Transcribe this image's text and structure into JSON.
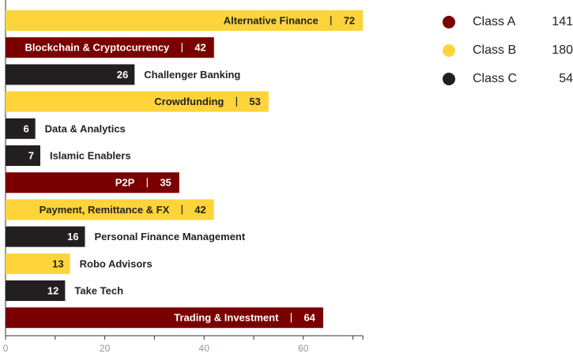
{
  "colors": {
    "Class A": "#7a0000",
    "Class B": "#ffd43b",
    "Class C": "#231f20"
  },
  "legend": [
    {
      "name": "Class A",
      "value": "141",
      "color": "#7a0000"
    },
    {
      "name": "Class B",
      "value": "180",
      "color": "#ffd43b"
    },
    {
      "name": "Class C",
      "value": "54",
      "color": "#231f20"
    }
  ],
  "chart_data": {
    "type": "bar",
    "orientation": "horizontal",
    "categories": [
      "Alternative Finance",
      "Blockchain & Cryptocurrency",
      "Challenger Banking",
      "Crowdfunding",
      "Data & Analytics",
      "Islamic Enablers",
      "P2P",
      "Payment, Remittance & FX",
      "Personal Finance Management",
      "Robo Advisors",
      "Take Tech",
      "Trading & Investment"
    ],
    "values": [
      72,
      42,
      26,
      53,
      6,
      7,
      35,
      42,
      16,
      13,
      12,
      64
    ],
    "classes": [
      "Class B",
      "Class A",
      "Class C",
      "Class B",
      "Class C",
      "Class C",
      "Class A",
      "Class B",
      "Class C",
      "Class B",
      "Class C",
      "Class A"
    ],
    "xlim": [
      0,
      72
    ],
    "xticks": [
      0,
      20,
      40,
      60
    ],
    "grid": false,
    "legend_position": "top-right",
    "title": "",
    "xlabel": "",
    "ylabel": ""
  }
}
